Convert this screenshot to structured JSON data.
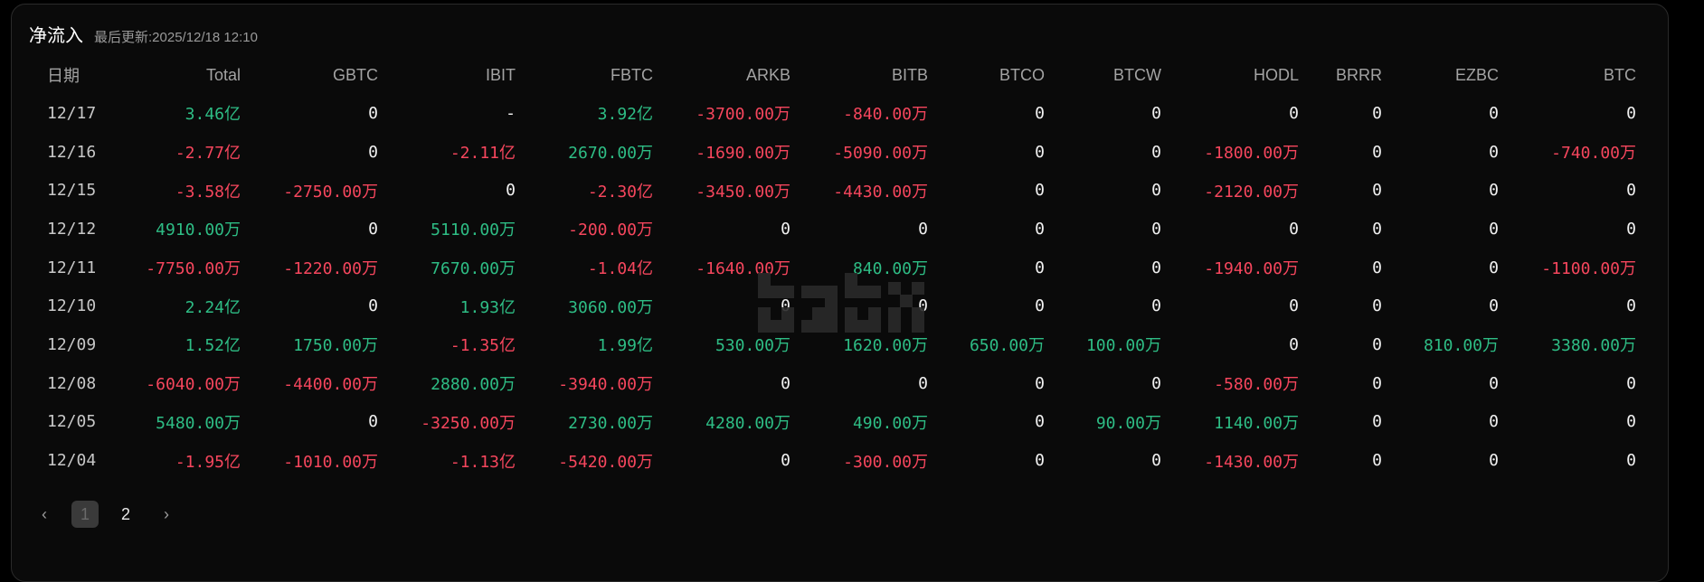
{
  "header": {
    "title": "净流入",
    "updated": "最后更新:2025/12/18 12:10"
  },
  "columns": [
    "日期",
    "Total",
    "GBTC",
    "IBIT",
    "FBTC",
    "ARKB",
    "BITB",
    "BTCO",
    "BTCW",
    "HODL",
    "BRRR",
    "EZBC",
    "BTC"
  ],
  "rows": [
    [
      "12/17",
      "3.46亿",
      "0",
      "-",
      "3.92亿",
      "-3700.00万",
      "-840.00万",
      "0",
      "0",
      "0",
      "0",
      "0",
      "0"
    ],
    [
      "12/16",
      "-2.77亿",
      "0",
      "-2.11亿",
      "2670.00万",
      "-1690.00万",
      "-5090.00万",
      "0",
      "0",
      "-1800.00万",
      "0",
      "0",
      "-740.00万"
    ],
    [
      "12/15",
      "-3.58亿",
      "-2750.00万",
      "0",
      "-2.30亿",
      "-3450.00万",
      "-4430.00万",
      "0",
      "0",
      "-2120.00万",
      "0",
      "0",
      "0"
    ],
    [
      "12/12",
      "4910.00万",
      "0",
      "5110.00万",
      "-200.00万",
      "0",
      "0",
      "0",
      "0",
      "0",
      "0",
      "0",
      "0"
    ],
    [
      "12/11",
      "-7750.00万",
      "-1220.00万",
      "7670.00万",
      "-1.04亿",
      "-1640.00万",
      "840.00万",
      "0",
      "0",
      "-1940.00万",
      "0",
      "0",
      "-1100.00万"
    ],
    [
      "12/10",
      "2.24亿",
      "0",
      "1.93亿",
      "3060.00万",
      "0",
      "0",
      "0",
      "0",
      "0",
      "0",
      "0",
      "0"
    ],
    [
      "12/09",
      "1.52亿",
      "1750.00万",
      "-1.35亿",
      "1.99亿",
      "530.00万",
      "1620.00万",
      "650.00万",
      "100.00万",
      "0",
      "0",
      "810.00万",
      "3380.00万"
    ],
    [
      "12/08",
      "-6040.00万",
      "-4400.00万",
      "2880.00万",
      "-3940.00万",
      "0",
      "0",
      "0",
      "0",
      "-580.00万",
      "0",
      "0",
      "0"
    ],
    [
      "12/05",
      "5480.00万",
      "0",
      "-3250.00万",
      "2730.00万",
      "4280.00万",
      "490.00万",
      "0",
      "90.00万",
      "1140.00万",
      "0",
      "0",
      "0"
    ],
    [
      "12/04",
      "-1.95亿",
      "-1010.00万",
      "-1.13亿",
      "-5420.00万",
      "0",
      "-300.00万",
      "0",
      "0",
      "-1430.00万",
      "0",
      "0",
      "0"
    ]
  ],
  "pagination": {
    "prev_icon": "chevron-left-icon",
    "next_icon": "chevron-right-icon",
    "pages": [
      "1",
      "2"
    ],
    "current": "1"
  },
  "colors": {
    "positive": "#2ebd85",
    "negative": "#f6465d",
    "neutral": "#f2f2f2"
  }
}
